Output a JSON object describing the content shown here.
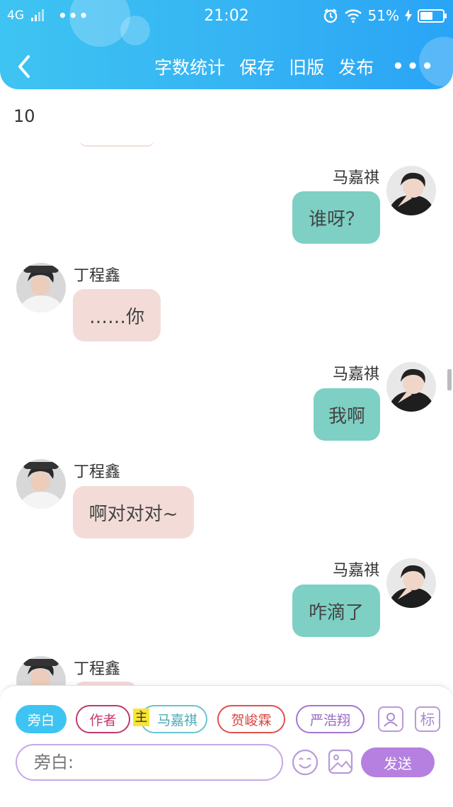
{
  "status_bar": {
    "network": "4G",
    "more": "•••",
    "time": "21:02",
    "battery": "51%"
  },
  "header": {
    "back_icon": "chevron-left-icon",
    "actions": [
      "字数统计",
      "保存",
      "旧版",
      "发布"
    ],
    "more": "•••"
  },
  "content": {
    "word_count": "10",
    "messages": [
      {
        "side": "right",
        "name": "马嘉祺",
        "text": "谁呀？"
      },
      {
        "side": "left",
        "name": "丁程鑫",
        "text": "……你"
      },
      {
        "side": "right",
        "name": "马嘉祺",
        "text": "我啊"
      },
      {
        "side": "left",
        "name": "丁程鑫",
        "text": "啊对对对~"
      },
      {
        "side": "right",
        "name": "马嘉祺",
        "text": "咋滴了"
      },
      {
        "side": "left",
        "name": "丁程鑫",
        "text": ""
      }
    ]
  },
  "role_bar": {
    "roles": [
      "旁白",
      "作者",
      "马嘉祺",
      "贺峻霖",
      "严浩翔"
    ],
    "main_tag": "主",
    "tag_button": "标"
  },
  "composer": {
    "placeholder": "旁白:",
    "send_label": "发送"
  },
  "colors": {
    "header_blue": "#35b3f3",
    "right_bubble": "#7dd0c3",
    "left_bubble": "#f3dcd8",
    "send_purple": "#b580e0"
  }
}
